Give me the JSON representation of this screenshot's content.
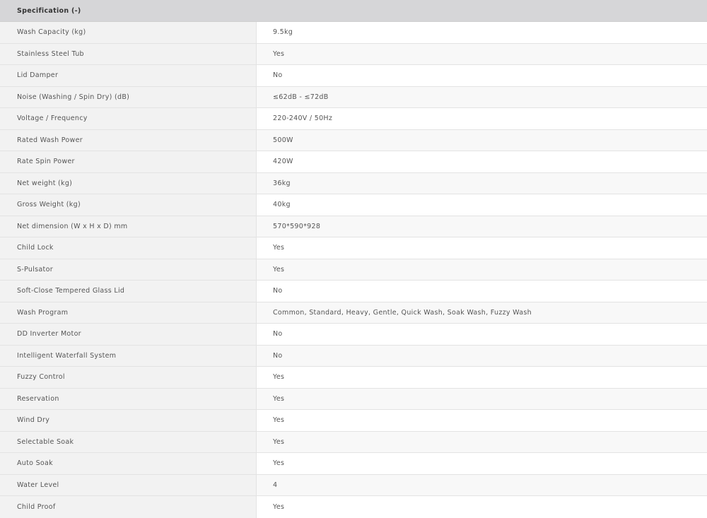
{
  "header": {
    "title": "Specification (-)"
  },
  "rows": [
    {
      "label": "Wash Capacity (kg)",
      "value": "9.5kg"
    },
    {
      "label": "Stainless Steel Tub",
      "value": "Yes"
    },
    {
      "label": "Lid Damper",
      "value": "No"
    },
    {
      "label": "Noise (Washing / Spin Dry) (dB)",
      "value": "≤62dB - ≤72dB"
    },
    {
      "label": "Voltage / Frequency",
      "value": "220-240V / 50Hz"
    },
    {
      "label": "Rated Wash Power",
      "value": "500W"
    },
    {
      "label": "Rate Spin Power",
      "value": "420W"
    },
    {
      "label": "Net weight (kg)",
      "value": "36kg"
    },
    {
      "label": "Gross Weight (kg)",
      "value": "40kg"
    },
    {
      "label": "Net dimension (W x H x D) mm",
      "value": "570*590*928"
    },
    {
      "label": "Child Lock",
      "value": "Yes"
    },
    {
      "label": "S-Pulsator",
      "value": "Yes"
    },
    {
      "label": "Soft-Close Tempered Glass Lid",
      "value": "No"
    },
    {
      "label": "Wash Program",
      "value": "Common, Standard, Heavy, Gentle, Quick Wash, Soak Wash, Fuzzy Wash"
    },
    {
      "label": "DD Inverter Motor",
      "value": "No"
    },
    {
      "label": "Intelligent Waterfall System",
      "value": "No"
    },
    {
      "label": "Fuzzy Control",
      "value": "Yes"
    },
    {
      "label": "Reservation",
      "value": "Yes"
    },
    {
      "label": "Wind Dry",
      "value": "Yes"
    },
    {
      "label": "Selectable Soak",
      "value": "Yes"
    },
    {
      "label": "Auto Soak",
      "value": "Yes"
    },
    {
      "label": "Water Level",
      "value": "4"
    },
    {
      "label": "Child Proof",
      "value": "Yes"
    }
  ]
}
